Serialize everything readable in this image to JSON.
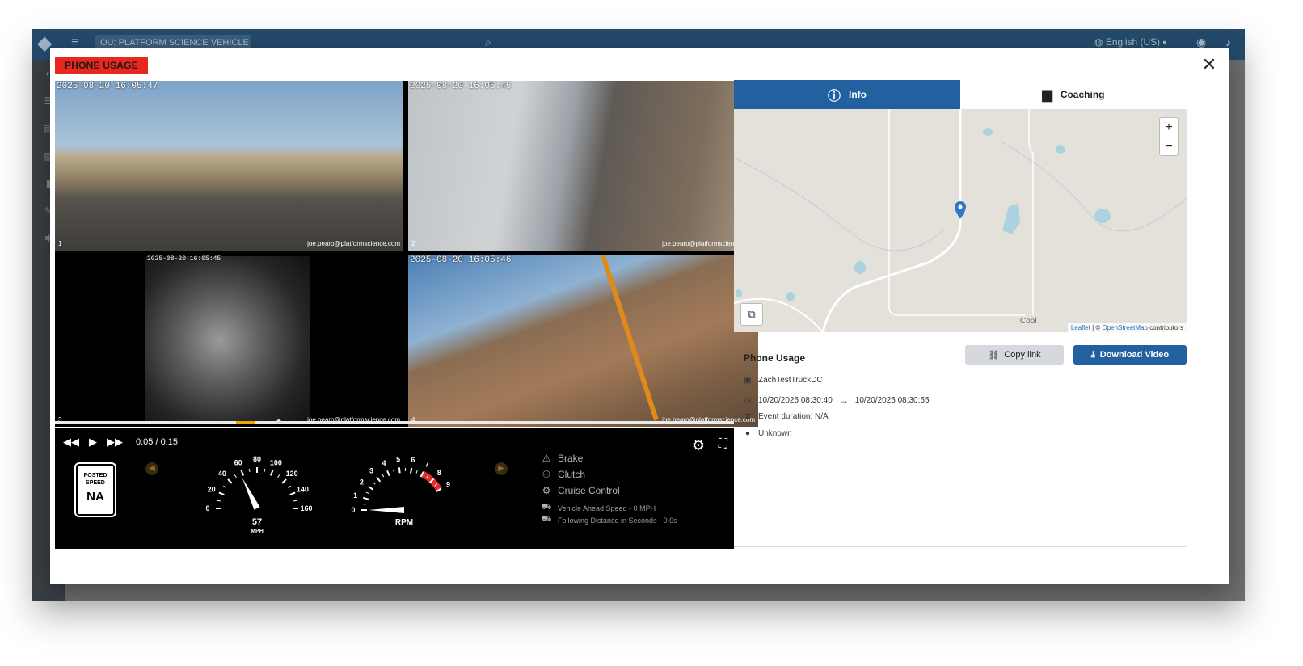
{
  "app": {
    "ou_label": "OU: PLATFORM SCIENCE VEHICLE TE...",
    "language": "English (US)"
  },
  "event": {
    "badge": "PHONE USAGE",
    "title": "Phone Usage"
  },
  "cameras": [
    {
      "timestamp": "2025-08-20 16:05:47",
      "number": "1",
      "email": "joe.pearo@platformscience.com"
    },
    {
      "timestamp": "2025-08-20 16:05:46",
      "number": "2",
      "email": "joe.pearo@platformscience.com"
    },
    {
      "timestamp": "2025-08-20 16:05:45",
      "number": "3",
      "email": "joe.pearo@platformscience.com"
    },
    {
      "timestamp": "2025-08-20 16:05:46",
      "number": "4",
      "email": "joe.pearo@platformscience.com"
    }
  ],
  "player": {
    "time": "0:05 / 0:15",
    "progress": 0.33
  },
  "telemetry": {
    "posted_speed_label": "POSTED SPEED",
    "posted_speed_value": "NA",
    "speed_value": "57",
    "speed_unit": "MPH",
    "speed_ticks": [
      "0",
      "20",
      "40",
      "60",
      "80",
      "100",
      "120",
      "140",
      "160"
    ],
    "rpm_label": "RPM",
    "rpm_ticks": [
      "0",
      "1",
      "2",
      "3",
      "4",
      "5",
      "6",
      "7",
      "8",
      "9"
    ],
    "indicators": [
      {
        "label": "Brake",
        "icon": "warning-icon"
      },
      {
        "label": "Clutch",
        "icon": "pedal-icon"
      },
      {
        "label": "Cruise Control",
        "icon": "cruise-icon"
      }
    ],
    "vehicle_ahead": "Vehicle Ahead Speed - 0 MPH",
    "following_distance": "Following Distance in Seconds - 0.0s"
  },
  "tabs": [
    {
      "label": "Info",
      "active": true
    },
    {
      "label": "Coaching",
      "active": false
    }
  ],
  "map": {
    "town": "Cool",
    "attribution_leaflet": "Leaflet",
    "attribution_sep": " | © ",
    "attribution_osm": "OpenStreetMap",
    "attribution_tail": " contributors"
  },
  "actions": {
    "copy_link": "Copy link",
    "download_video": "Download Video"
  },
  "details": {
    "vehicle": "ZachTestTruckDC",
    "start_time": "10/20/2025 08:30:40",
    "end_time": "10/20/2025 08:30:55",
    "duration": "Event duration: N/A",
    "driver": "Unknown"
  },
  "colors": {
    "badge_red": "#e8281e",
    "primary_blue": "#23609f",
    "topbar": "#244a6b"
  }
}
